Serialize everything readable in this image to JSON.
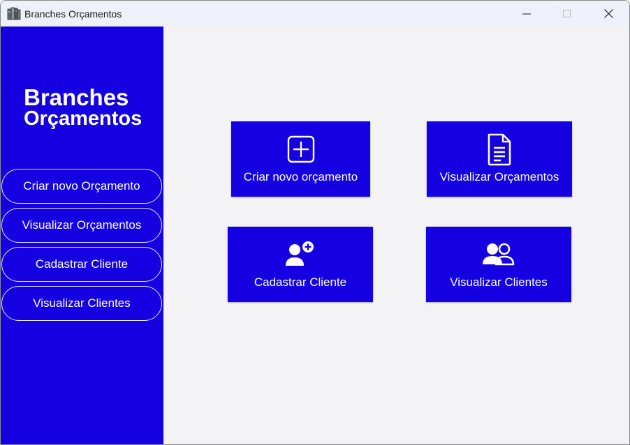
{
  "window": {
    "title": "Branches Orçamentos",
    "controls": [
      "minimize",
      "maximize",
      "close"
    ]
  },
  "sidebar": {
    "brand_line1": "Branches",
    "brand_line2": "Orçamentos",
    "items": [
      {
        "label": "Criar novo Orçamento"
      },
      {
        "label": "Visualizar Orçamentos"
      },
      {
        "label": "Cadastrar Cliente"
      },
      {
        "label": "Visualizar Clientes"
      }
    ]
  },
  "main": {
    "tiles": [
      {
        "label": "Criar novo orçamento",
        "icon": "plus-square-icon"
      },
      {
        "label": "Visualizar Orçamentos",
        "icon": "document-icon"
      },
      {
        "label": "Cadastrar Cliente",
        "icon": "add-user-icon"
      },
      {
        "label": "Visualizar Clientes",
        "icon": "users-icon"
      }
    ]
  },
  "colors": {
    "accent": "#1400e0",
    "background": "#f3f3f5",
    "titlebar": "#eef1f9",
    "text_on_accent": "#ffffff"
  }
}
